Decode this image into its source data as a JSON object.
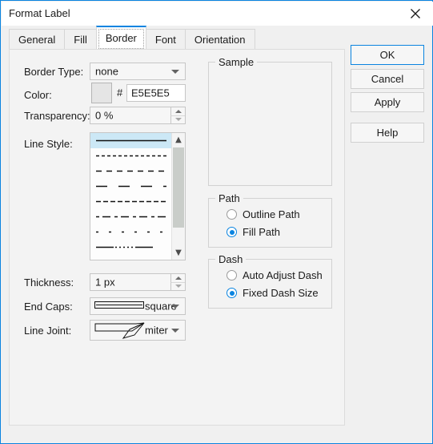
{
  "window": {
    "title": "Format Label",
    "close_icon": "close-icon",
    "accent_color": "#0a84e0"
  },
  "tabs": [
    {
      "label": "General",
      "active": false
    },
    {
      "label": "Fill",
      "active": false
    },
    {
      "label": "Border",
      "active": true
    },
    {
      "label": "Font",
      "active": false
    },
    {
      "label": "Orientation",
      "active": false
    }
  ],
  "border": {
    "border_type_label": "Border Type:",
    "border_type_value": "none",
    "color_label": "Color:",
    "color_hash": "#",
    "color_swatch_hex": "#E5E5E5",
    "color_value": "E5E5E5",
    "transparency_label": "Transparency:",
    "transparency_value": "0 %",
    "line_style_label": "Line Style:",
    "line_styles": [
      {
        "name": "solid",
        "dash": "",
        "selected": true
      },
      {
        "name": "fine-dash",
        "dash": "4 3",
        "selected": false
      },
      {
        "name": "medium-dash",
        "dash": "7 6",
        "selected": false
      },
      {
        "name": "long-dash",
        "dash": "14 14",
        "selected": false
      },
      {
        "name": "dense-dash",
        "dash": "6 3",
        "selected": false
      },
      {
        "name": "dash-dot-mixed",
        "dash": "4 4 10 5",
        "selected": false
      },
      {
        "name": "sparse-dot",
        "dash": "3 13",
        "selected": false
      },
      {
        "name": "solid-dot-solid",
        "dash": "22 2 2 3 2 3 2 3 2 3 2 3 22",
        "selected": false
      }
    ],
    "thickness_label": "Thickness:",
    "thickness_value": "1 px",
    "end_caps_label": "End Caps:",
    "end_caps_value": "square",
    "line_joint_label": "Line Joint:",
    "line_joint_value": "miter"
  },
  "sample": {
    "title": "Sample"
  },
  "path": {
    "title": "Path",
    "options": [
      {
        "label": "Outline Path",
        "selected": false
      },
      {
        "label": "Fill Path",
        "selected": true
      }
    ]
  },
  "dash": {
    "title": "Dash",
    "options": [
      {
        "label": "Auto Adjust Dash",
        "selected": false
      },
      {
        "label": "Fixed Dash Size",
        "selected": true
      }
    ]
  },
  "buttons": {
    "ok": "OK",
    "cancel": "Cancel",
    "apply": "Apply",
    "help": "Help"
  }
}
